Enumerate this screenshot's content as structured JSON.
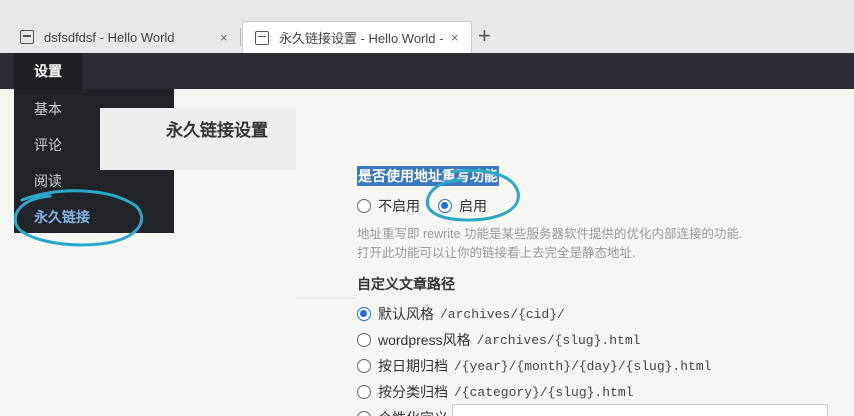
{
  "browser": {
    "tabs": [
      {
        "title": "dsfsdfdsf - Hello World",
        "close": "×"
      },
      {
        "title": "永久链接设置 - Hello World -",
        "close": "×"
      }
    ],
    "new_tab": "+"
  },
  "admin_bar": {
    "menu_label": "设置"
  },
  "settings_menu": {
    "items": [
      {
        "label": "基本"
      },
      {
        "label": "评论"
      },
      {
        "label": "阅读"
      },
      {
        "label": "永久链接"
      }
    ],
    "active_index": 3
  },
  "page": {
    "title": "永久链接设置"
  },
  "rewrite": {
    "question": "是否使用地址重写功能",
    "options": [
      {
        "label": "不启用",
        "checked": false
      },
      {
        "label": "启用",
        "checked": true
      }
    ],
    "description_line1": "地址重写即 rewrite 功能是某些服务器软件提供的优化内部连接的功能.",
    "description_line2": "打开此功能可以让你的链接看上去完全是静态地址."
  },
  "path": {
    "title": "自定义文章路径",
    "options": [
      {
        "label": "默认风格",
        "pattern": "/archives/{cid}/",
        "checked": true
      },
      {
        "label": "wordpress风格",
        "pattern": "/archives/{slug}.html",
        "checked": false
      },
      {
        "label": "按日期归档",
        "pattern": "/{year}/{month}/{day}/{slug}.html",
        "checked": false
      },
      {
        "label": "按分类归档",
        "pattern": "/{category}/{slug}.html",
        "checked": false
      },
      {
        "label": "个性化定义",
        "pattern": "",
        "checked": false
      }
    ]
  },
  "colors": {
    "admin_bar": "#292d33",
    "dropdown_bg": "#202327",
    "highlight": "#3b78c4",
    "radio_checked": "#1a6fe0",
    "annotation": "#2aa8c8"
  }
}
